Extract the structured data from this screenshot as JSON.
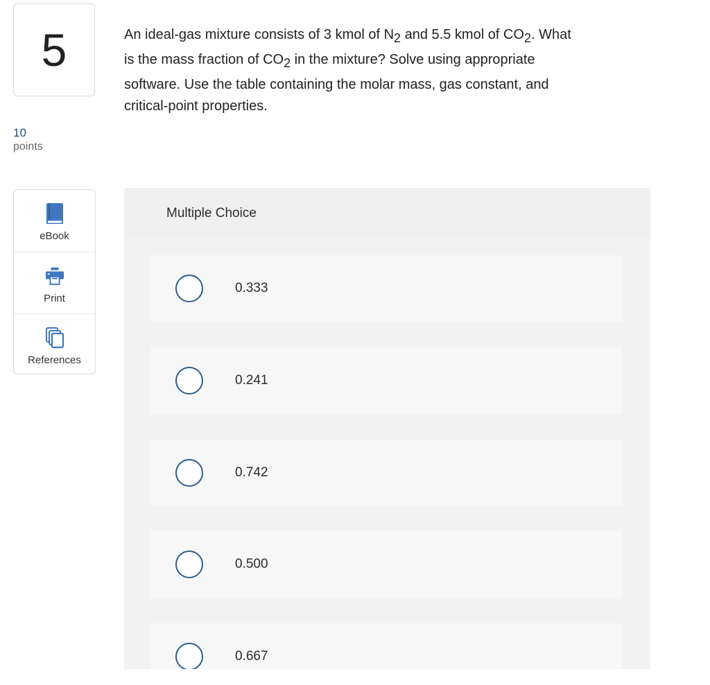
{
  "question": {
    "number": "5",
    "points_value": "10",
    "points_label": "points",
    "text": {
      "part1": "An ideal-gas mixture consists of 3 kmol of N",
      "sub1": "2",
      "part2": " and 5.5 kmol of CO",
      "sub2": "2",
      "part3": ". What",
      "part4": "is the mass fraction of CO",
      "sub3": "2",
      "part5": " in the mixture? Solve using appropriate",
      "line3": "software. Use the table containing the molar mass, gas constant, and",
      "line4": "critical-point properties."
    }
  },
  "tools": [
    {
      "label": "eBook",
      "icon": "book-icon"
    },
    {
      "label": "Print",
      "icon": "printer-icon"
    },
    {
      "label": "References",
      "icon": "copy-icon"
    }
  ],
  "multiple_choice": {
    "title": "Multiple Choice",
    "options": [
      {
        "label": "0.333"
      },
      {
        "label": "0.241"
      },
      {
        "label": "0.742"
      },
      {
        "label": "0.500"
      },
      {
        "label": "0.667"
      }
    ]
  },
  "colors": {
    "accent": "#2b5f92",
    "icon_blue": "#3f77c0",
    "panel_bg": "#f0f0f0",
    "option_bg": "#f7f7f7"
  }
}
